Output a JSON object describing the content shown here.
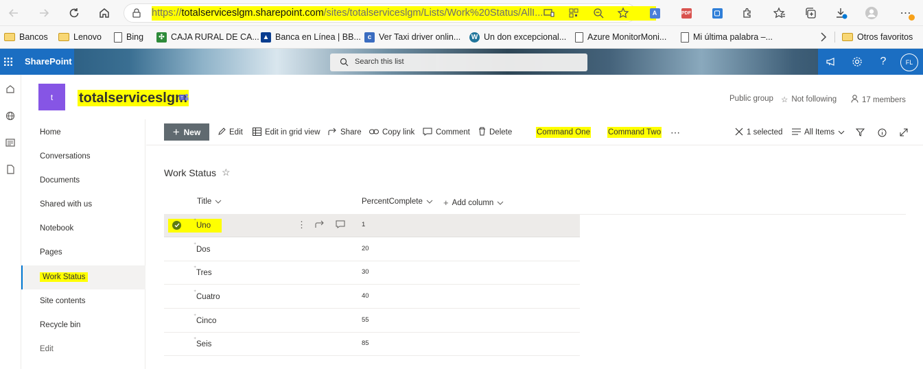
{
  "browser": {
    "url_prefix": "https://",
    "url_domain": "totalserviceslgm.sharepoint.com",
    "url_path": "/sites/totalserviceslgm/Lists/Work%20Status/AllI...",
    "favorites": [
      {
        "label": "Bancos",
        "icon": "folder-icon"
      },
      {
        "label": "Lenovo",
        "icon": "folder-icon"
      },
      {
        "label": "Bing",
        "icon": "page-icon"
      },
      {
        "label": "CAJA RURAL DE CA...",
        "icon": "cajarural-icon"
      },
      {
        "label": "Banca en Línea | BB...",
        "icon": "bbva-icon"
      },
      {
        "label": "Ver Taxi driver onlin...",
        "icon": "taxi-icon"
      },
      {
        "label": "Un don excepcional...",
        "icon": "wordpress-icon"
      },
      {
        "label": "Azure MonitorMoni...",
        "icon": "page-icon"
      },
      {
        "label": "Mi última palabra –...",
        "icon": "page-icon"
      }
    ],
    "other_favorites": "Otros favoritos"
  },
  "suite": {
    "brand": "SharePoint",
    "search_placeholder": "Search this list",
    "avatar": "FL"
  },
  "site": {
    "logo_letter": "t",
    "title": "totalserviceslgm",
    "group": "Public group",
    "follow": "Not following",
    "members": "17 members"
  },
  "nav": {
    "items": [
      {
        "label": "Home"
      },
      {
        "label": "Conversations"
      },
      {
        "label": "Documents"
      },
      {
        "label": "Shared with us"
      },
      {
        "label": "Notebook"
      },
      {
        "label": "Pages"
      },
      {
        "label": "Work Status"
      },
      {
        "label": "Site contents"
      },
      {
        "label": "Recycle bin"
      },
      {
        "label": "Edit"
      }
    ]
  },
  "commands": {
    "new": "New",
    "edit": "Edit",
    "grid": "Edit in grid view",
    "share": "Share",
    "copy_link": "Copy link",
    "comment": "Comment",
    "delete": "Delete",
    "command_one": "Command One",
    "command_two": "Command Two",
    "more": "⋯",
    "selected": "1 selected",
    "view": "All Items"
  },
  "list": {
    "title": "Work Status",
    "columns": {
      "title": "Title",
      "percent": "PercentComplete",
      "add": "Add column"
    },
    "rows": [
      {
        "title": "Uno",
        "percent": "1"
      },
      {
        "title": "Dos",
        "percent": "20"
      },
      {
        "title": "Tres",
        "percent": "30"
      },
      {
        "title": "Cuatro",
        "percent": "40"
      },
      {
        "title": "Cinco",
        "percent": "55"
      },
      {
        "title": "Seis",
        "percent": "85"
      }
    ]
  }
}
